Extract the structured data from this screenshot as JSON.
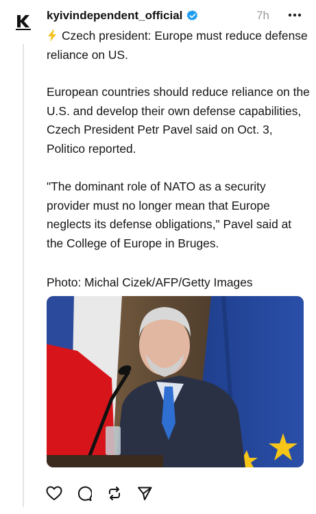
{
  "post": {
    "username": "kyivindependent_official",
    "time": "7h",
    "headline_icon": "lightning-bolt-icon",
    "headline": "Czech president: Europe must reduce defense reliance on US.",
    "paragraph_1": "European countries should reduce reliance on the U.S. and develop their own defense capabilities, Czech President Petr Pavel said on Oct. 3, Politico reported.",
    "paragraph_2": "\"The dominant role of NATO as a security provider must no longer mean that Europe neglects its defense obligations,\" Pavel said at the College of Europe in Bruges.",
    "photo_credit": "Photo: Michal Cizek/AFP/Getty Images"
  },
  "avatar": {
    "letter": "K"
  },
  "colors": {
    "verified": "#1d9bf0",
    "bolt": "#f3c31b",
    "eu_blue": "#1f3e8c",
    "czech_red": "#d7141a"
  },
  "actions": [
    "heart-icon",
    "comment-icon",
    "repost-icon",
    "share-icon"
  ]
}
